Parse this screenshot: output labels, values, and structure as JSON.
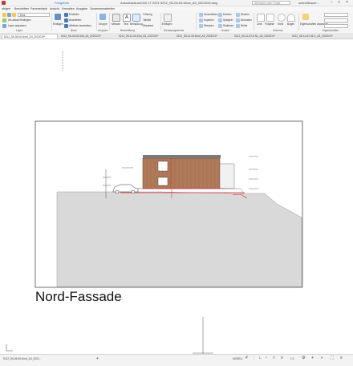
{
  "titlebar": {
    "quick_link": "Freigeben",
    "title": "AutodeskAutoCAD LT 2021   5212_S6-06-06-Nord_A3_2022019.dwg",
    "search_placeholder": "Stichwort oder Frage eingeben",
    "user": "schnellbauer..."
  },
  "menu": [
    "nfügen",
    "Beschriften",
    "Parametrisch",
    "Ansicht",
    "Verwalten",
    "Ausgabe",
    "Zusammenarbeiten"
  ],
  "ribbon": {
    "layer_name": "Esrs",
    "layer_current": "Als aktuell festlegen",
    "layer_match": "Layer anpassen",
    "insert": "Einfügen",
    "block_create": "Erstellen",
    "block_edit": "Bearbeiten",
    "block_attr": "Attribute bearbeiten",
    "groups": "Gruppe",
    "measure": "Messen",
    "text": "Text",
    "dimension": "Bemaßung",
    "leader": "Führung",
    "table": "Tabelle",
    "text_style": "Standard",
    "insert_clip": "Einfügen",
    "clipboard_insert": "Verschieben",
    "copy": "Kopieren",
    "stretch": "Strecken",
    "rotate": "Drehen",
    "mirror": "Spiegeln",
    "scale": "Skalieren",
    "trim": "Stutzen",
    "fillet": "Abrunden",
    "array": "Reihe",
    "line": "Linie",
    "polyline": "Polylinie",
    "circle": "Kreis",
    "arc": "Bogen",
    "properties_match": "Eigenschaften anpassen",
    "group_labels": [
      "Layer",
      "Block",
      "Gruppen",
      "Beschriftung",
      "Dienstprogramme",
      "Ändern",
      "Zeichnen",
      "Eigenschaften"
    ]
  },
  "file_tabs": [
    "5212_S6-06-06-Nord_A3_2022019*",
    "5212_S6-06-06-Süd_A3_2022019*",
    "5212_S6-11-06-Süd_A3_2022019*",
    "5212_S6-11-06-Nord_A3_2022019*",
    "5212_S6-11-AT-6-NL_A3_2022019*",
    "5212_S6-11-AT-06-S_A3_2022019*"
  ],
  "drawing": {
    "view_title": "Nord-Fassade"
  },
  "statusbar": {
    "layout_tab": "5212_S6-06-06-Nord_A3_2022...",
    "model": "MODELL",
    "scale": "1:1"
  },
  "colors": {
    "facade_wood": "#b07a5a",
    "dimension_red": "#d8262a",
    "terrain_grey": "#d9d9d9",
    "accent_blue": "#1f6fc5"
  }
}
